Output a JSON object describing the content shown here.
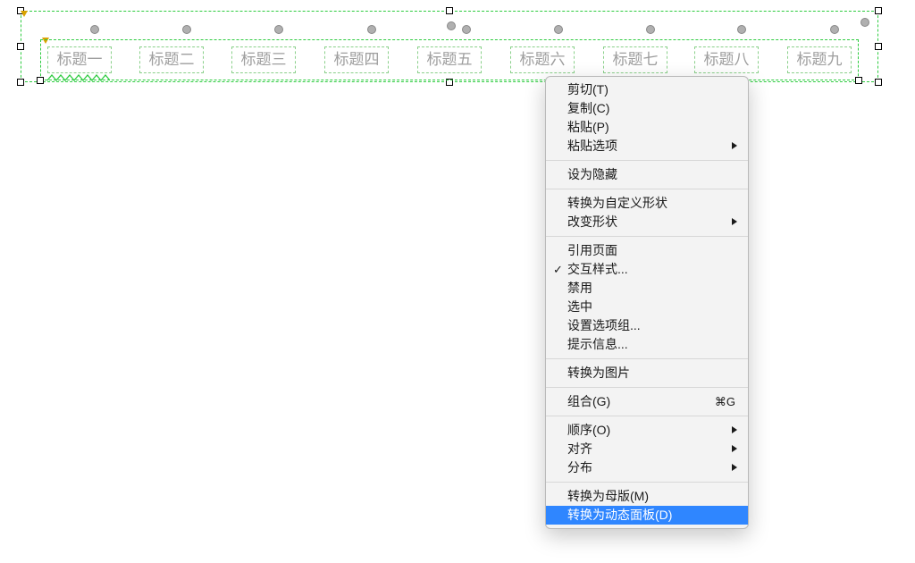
{
  "titles": [
    "标题一",
    "标题二",
    "标题三",
    "标题四",
    "标题五",
    "标题六",
    "标题七",
    "标题八",
    "标题九"
  ],
  "menu": {
    "cut": "剪切(T)",
    "copy": "复制(C)",
    "paste": "粘贴(P)",
    "paste_options": "粘贴选项",
    "set_hidden": "设为隐藏",
    "convert_custom_shape": "转换为自定义形状",
    "change_shape": "改变形状",
    "reference_page": "引用页面",
    "interaction_styles": "交互样式...",
    "disable": "禁用",
    "selected": "选中",
    "set_option_group": "设置选项组...",
    "tooltip": "提示信息...",
    "convert_to_image": "转换为图片",
    "group": "组合(G)",
    "group_shortcut": "⌘G",
    "order": "顺序(O)",
    "align": "对齐",
    "distribute": "分布",
    "convert_to_master": "转换为母版(M)",
    "convert_to_dynamic_panel": "转换为动态面板(D)"
  }
}
